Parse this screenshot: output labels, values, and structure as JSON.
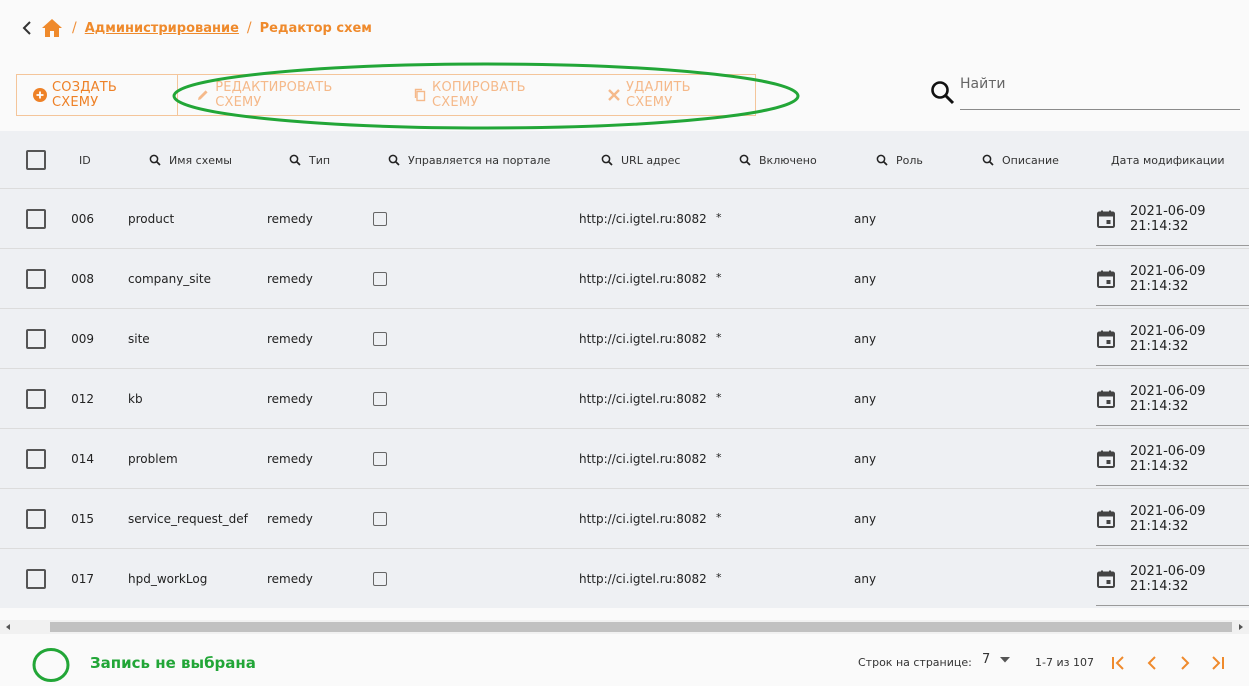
{
  "breadcrumb": {
    "admin": "Администрирование",
    "current": "Редактор схем"
  },
  "toolbar": {
    "create": "СОЗДАТЬ СХЕМУ",
    "edit": "РЕДАКТИРОВАТЬ СХЕМУ",
    "copy": "КОПИРОВАТЬ СХЕМУ",
    "delete": "УДАЛИТЬ СХЕМУ"
  },
  "search": {
    "placeholder": "Найти"
  },
  "columns": {
    "id": "ID",
    "name": "Имя схемы",
    "type": "Тип",
    "portal": "Управляется на портале",
    "url": "URL адрес",
    "enabled": "Включено",
    "role": "Роль",
    "description": "Описание",
    "modified": "Дата модификации"
  },
  "rows": [
    {
      "id": "006",
      "name": "product",
      "type": "remedy",
      "url": "http://ci.igtel.ru:8082",
      "enabled": "*",
      "role": "any",
      "date": "2021-06-09 21:14:32"
    },
    {
      "id": "008",
      "name": "company_site",
      "type": "remedy",
      "url": "http://ci.igtel.ru:8082",
      "enabled": "*",
      "role": "any",
      "date": "2021-06-09 21:14:32"
    },
    {
      "id": "009",
      "name": "site",
      "type": "remedy",
      "url": "http://ci.igtel.ru:8082",
      "enabled": "*",
      "role": "any",
      "date": "2021-06-09 21:14:32"
    },
    {
      "id": "012",
      "name": "kb",
      "type": "remedy",
      "url": "http://ci.igtel.ru:8082",
      "enabled": "*",
      "role": "any",
      "date": "2021-06-09 21:14:32"
    },
    {
      "id": "014",
      "name": "problem",
      "type": "remedy",
      "url": "http://ci.igtel.ru:8082",
      "enabled": "*",
      "role": "any",
      "date": "2021-06-09 21:14:32"
    },
    {
      "id": "015",
      "name": "service_request_def",
      "type": "remedy",
      "url": "http://ci.igtel.ru:8082",
      "enabled": "*",
      "role": "any",
      "date": "2021-06-09 21:14:32"
    },
    {
      "id": "017",
      "name": "hpd_workLog",
      "type": "remedy",
      "url": "http://ci.igtel.ru:8082",
      "enabled": "*",
      "role": "any",
      "date": "2021-06-09 21:14:32"
    }
  ],
  "footer": {
    "status": "Запись не выбрана",
    "rows_per_page_label": "Строк на странице:",
    "rows_per_page": "7",
    "range": "1-7 из 107"
  },
  "colors": {
    "accent": "#ee8127",
    "accent_disabled": "#f5b98a",
    "annotation": "#22a637"
  }
}
